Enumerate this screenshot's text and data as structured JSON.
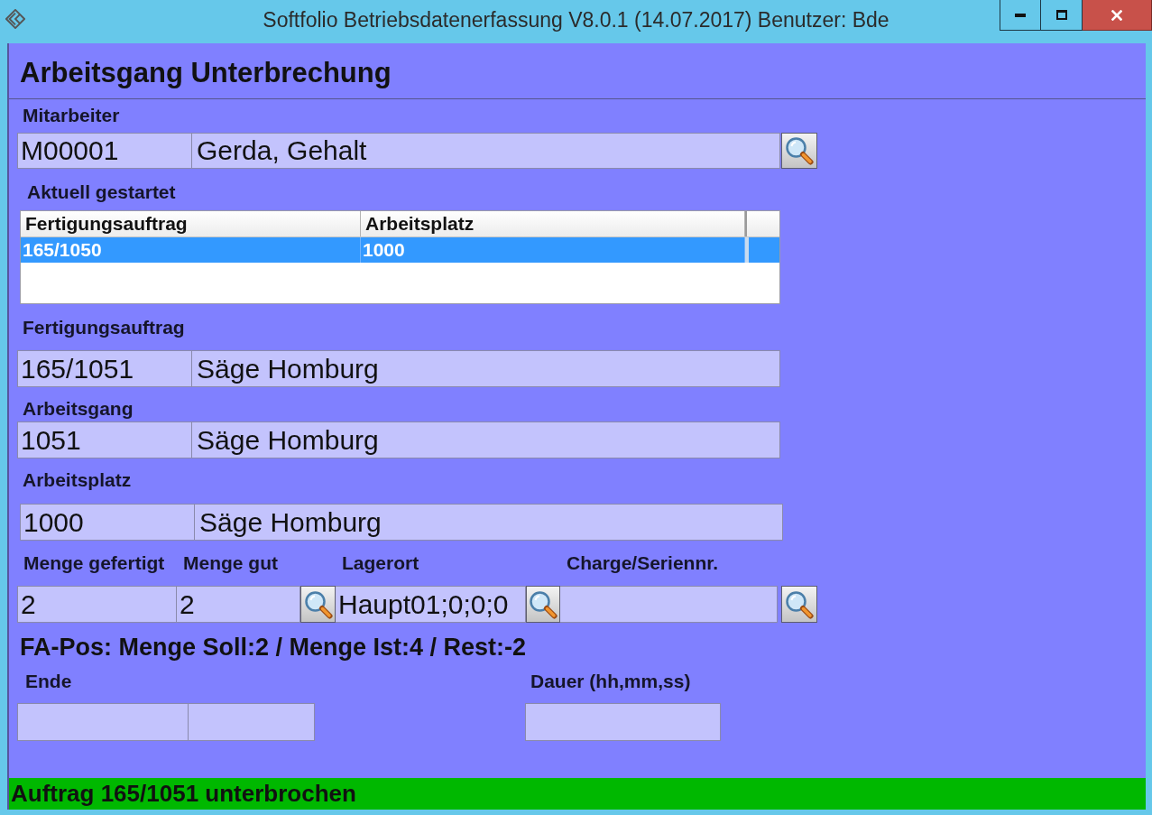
{
  "window": {
    "title": "Softfolio Betriebsdatenerfassung V8.0.1 (14.07.2017) Benutzer: Bde"
  },
  "form": {
    "heading": "Arbeitsgang Unterbrechung",
    "employee": {
      "label": "Mitarbeiter",
      "code": "M00001",
      "name": "Gerda, Gehalt"
    },
    "started": {
      "label": "Aktuell gestartet",
      "columns": [
        "Fertigungsauftrag",
        "Arbeitsplatz"
      ],
      "rows": [
        {
          "cells": [
            "165/1050",
            "1000"
          ],
          "selected": true
        }
      ]
    },
    "records": [
      {
        "label": "Fertigungsauftrag",
        "code": "165/1051",
        "description": "Säge Homburg"
      },
      {
        "label": "Arbeitsgang",
        "code": "1051",
        "description": "Säge Homburg"
      },
      {
        "label": "Arbeitsplatz",
        "code": "1000",
        "description": "Säge Homburg"
      }
    ],
    "quantities": [
      {
        "kind": "plain",
        "label": "Menge gefertigt",
        "value": "2"
      },
      {
        "kind": "lookup",
        "label": "Menge gut",
        "value": "2"
      },
      {
        "kind": "lookup",
        "label": "Lagerort",
        "value": "Haupt01;0;0;0"
      },
      {
        "kind": "lookup",
        "label": "Charge/Seriennr."
      }
    ],
    "summary": "FA-Pos: Menge Soll:2 / Menge Ist:4 / Rest:-2",
    "end": {
      "label": "Ende"
    },
    "duration": {
      "label": "Dauer (hh,mm,ss)"
    }
  },
  "status_bar": {
    "message": "Auftrag 165/1051 unterbrochen"
  }
}
